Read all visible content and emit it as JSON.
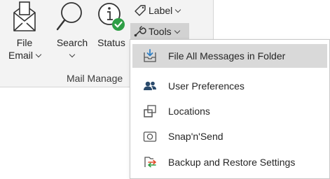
{
  "ribbon": {
    "file_email": {
      "line1": "File",
      "line2": "Email",
      "icon": "envelope-icon"
    },
    "search": {
      "line1": "Search",
      "icon": "magnifier-icon"
    },
    "status": {
      "line1": "Status",
      "icon": "info-check-icon"
    },
    "label": {
      "label": "Label",
      "icon": "tag-icon"
    },
    "tools": {
      "label": "Tools",
      "icon": "wrench-icon"
    },
    "group_label": "Mail Manage"
  },
  "tools_menu": {
    "items": [
      {
        "label": "File All Messages in Folder",
        "icon": "file-folder-icon",
        "highlighted": true
      },
      {
        "label": "User Preferences",
        "icon": "users-icon"
      },
      {
        "label": "Locations",
        "icon": "locations-icon"
      },
      {
        "label": "Snap'n'Send",
        "icon": "camera-icon"
      },
      {
        "label": "Backup and Restore Settings",
        "icon": "backup-restore-icon"
      }
    ]
  },
  "colors": {
    "ribbon_bg": "#f3f3f3",
    "highlight": "#d9d9d9",
    "accent_blue": "#2f7fc4",
    "status_green": "#2e9e45"
  }
}
